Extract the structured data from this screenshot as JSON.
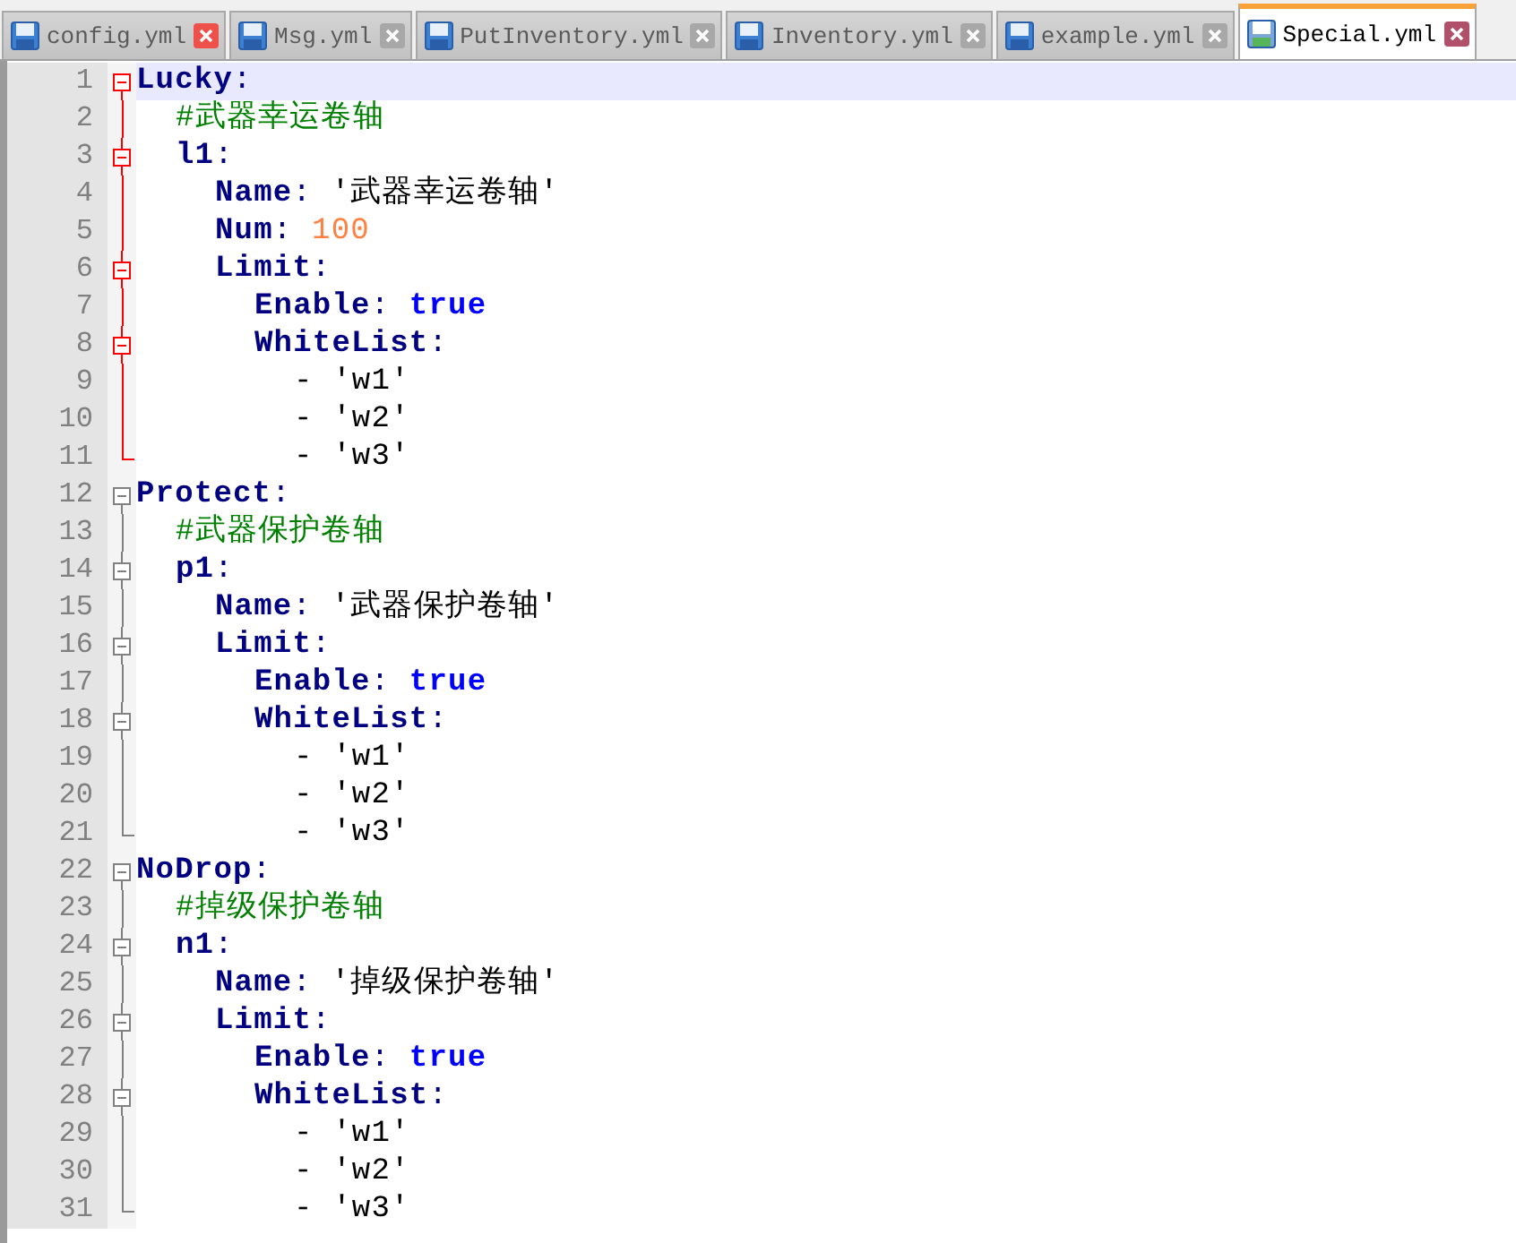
{
  "tabs": [
    {
      "label": "config.yml",
      "selected": false,
      "close_hot": true
    },
    {
      "label": "Msg.yml",
      "selected": false,
      "close_hot": false
    },
    {
      "label": "PutInventory.yml",
      "selected": false,
      "close_hot": false
    },
    {
      "label": "Inventory.yml",
      "selected": false,
      "close_hot": false
    },
    {
      "label": "example.yml",
      "selected": false,
      "close_hot": false
    },
    {
      "label": "Special.yml",
      "selected": true,
      "close_hot": false
    }
  ],
  "lines": [
    {
      "number": "1",
      "current": true,
      "active_fold": true,
      "tokens": [
        {
          "kind": "key",
          "text": "Lucky"
        },
        {
          "kind": "op",
          "text": ":"
        }
      ],
      "children": [
        {
          "number": "2",
          "current": false,
          "tokens": [
            {
              "kind": "comment",
              "text": "#武器幸运卷轴"
            }
          ]
        },
        {
          "number": "3",
          "current": false,
          "tokens": [
            {
              "kind": "key",
              "text": "l1"
            },
            {
              "kind": "op",
              "text": ":"
            }
          ],
          "children": [
            {
              "number": "4",
              "current": false,
              "tokens": [
                {
                  "kind": "key",
                  "text": "Name"
                },
                {
                  "kind": "op",
                  "text": ": "
                },
                {
                  "kind": "string",
                  "text": "'武器幸运卷轴'"
                }
              ]
            },
            {
              "number": "5",
              "current": false,
              "tokens": [
                {
                  "kind": "key",
                  "text": "Num"
                },
                {
                  "kind": "op",
                  "text": ": "
                },
                {
                  "kind": "number",
                  "text": "100"
                }
              ]
            },
            {
              "number": "6",
              "current": false,
              "tokens": [
                {
                  "kind": "key",
                  "text": "Limit"
                },
                {
                  "kind": "op",
                  "text": ":"
                }
              ],
              "children": [
                {
                  "number": "7",
                  "current": false,
                  "tokens": [
                    {
                      "kind": "key",
                      "text": "Enable"
                    },
                    {
                      "kind": "op",
                      "text": ": "
                    },
                    {
                      "kind": "bool",
                      "text": "true"
                    }
                  ]
                },
                {
                  "number": "8",
                  "current": false,
                  "tokens": [
                    {
                      "kind": "key",
                      "text": "WhiteList"
                    },
                    {
                      "kind": "op",
                      "text": ":"
                    }
                  ],
                  "children": [
                    {
                      "number": "9",
                      "current": false,
                      "tokens": [
                        {
                          "kind": "string",
                          "text": "- 'w1'"
                        }
                      ]
                    },
                    {
                      "number": "10",
                      "current": false,
                      "tokens": [
                        {
                          "kind": "string",
                          "text": "- 'w2'"
                        }
                      ]
                    },
                    {
                      "number": "11",
                      "current": false,
                      "tokens": [
                        {
                          "kind": "string",
                          "text": "- 'w3'"
                        }
                      ]
                    }
                  ]
                }
              ]
            }
          ]
        }
      ]
    },
    {
      "number": "12",
      "current": false,
      "active_fold": false,
      "tokens": [
        {
          "kind": "key",
          "text": "Protect"
        },
        {
          "kind": "op",
          "text": ":"
        }
      ],
      "children": [
        {
          "number": "13",
          "current": false,
          "tokens": [
            {
              "kind": "comment",
              "text": "#武器保护卷轴"
            }
          ]
        },
        {
          "number": "14",
          "current": false,
          "tokens": [
            {
              "kind": "key",
              "text": "p1"
            },
            {
              "kind": "op",
              "text": ":"
            }
          ],
          "children": [
            {
              "number": "15",
              "current": false,
              "tokens": [
                {
                  "kind": "key",
                  "text": "Name"
                },
                {
                  "kind": "op",
                  "text": ": "
                },
                {
                  "kind": "string",
                  "text": "'武器保护卷轴'"
                }
              ]
            },
            {
              "number": "16",
              "current": false,
              "tokens": [
                {
                  "kind": "key",
                  "text": "Limit"
                },
                {
                  "kind": "op",
                  "text": ":"
                }
              ],
              "children": [
                {
                  "number": "17",
                  "current": false,
                  "tokens": [
                    {
                      "kind": "key",
                      "text": "Enable"
                    },
                    {
                      "kind": "op",
                      "text": ": "
                    },
                    {
                      "kind": "bool",
                      "text": "true"
                    }
                  ]
                },
                {
                  "number": "18",
                  "current": false,
                  "tokens": [
                    {
                      "kind": "key",
                      "text": "WhiteList"
                    },
                    {
                      "kind": "op",
                      "text": ":"
                    }
                  ],
                  "children": [
                    {
                      "number": "19",
                      "current": false,
                      "tokens": [
                        {
                          "kind": "string",
                          "text": "- 'w1'"
                        }
                      ]
                    },
                    {
                      "number": "20",
                      "current": false,
                      "tokens": [
                        {
                          "kind": "string",
                          "text": "- 'w2'"
                        }
                      ]
                    },
                    {
                      "number": "21",
                      "current": false,
                      "tokens": [
                        {
                          "kind": "string",
                          "text": "- 'w3'"
                        }
                      ]
                    }
                  ]
                }
              ]
            }
          ]
        }
      ]
    },
    {
      "number": "22",
      "current": false,
      "active_fold": false,
      "tokens": [
        {
          "kind": "key",
          "text": "NoDrop"
        },
        {
          "kind": "op",
          "text": ":"
        }
      ],
      "children": [
        {
          "number": "23",
          "current": false,
          "tokens": [
            {
              "kind": "comment",
              "text": "#掉级保护卷轴"
            }
          ]
        },
        {
          "number": "24",
          "current": false,
          "tokens": [
            {
              "kind": "key",
              "text": "n1"
            },
            {
              "kind": "op",
              "text": ":"
            }
          ],
          "children": [
            {
              "number": "25",
              "current": false,
              "tokens": [
                {
                  "kind": "key",
                  "text": "Name"
                },
                {
                  "kind": "op",
                  "text": ": "
                },
                {
                  "kind": "string",
                  "text": "'掉级保护卷轴'"
                }
              ]
            },
            {
              "number": "26",
              "current": false,
              "tokens": [
                {
                  "kind": "key",
                  "text": "Limit"
                },
                {
                  "kind": "op",
                  "text": ":"
                }
              ],
              "children": [
                {
                  "number": "27",
                  "current": false,
                  "tokens": [
                    {
                      "kind": "key",
                      "text": "Enable"
                    },
                    {
                      "kind": "op",
                      "text": ": "
                    },
                    {
                      "kind": "bool",
                      "text": "true"
                    }
                  ]
                },
                {
                  "number": "28",
                  "current": false,
                  "tokens": [
                    {
                      "kind": "key",
                      "text": "WhiteList"
                    },
                    {
                      "kind": "op",
                      "text": ":"
                    }
                  ],
                  "children": [
                    {
                      "number": "29",
                      "current": false,
                      "tokens": [
                        {
                          "kind": "string",
                          "text": "- 'w1'"
                        }
                      ]
                    },
                    {
                      "number": "30",
                      "current": false,
                      "tokens": [
                        {
                          "kind": "string",
                          "text": "- 'w2'"
                        }
                      ]
                    },
                    {
                      "number": "31",
                      "current": false,
                      "tokens": [
                        {
                          "kind": "string",
                          "text": "- 'w3'"
                        }
                      ]
                    }
                  ]
                }
              ]
            }
          ]
        }
      ]
    }
  ]
}
